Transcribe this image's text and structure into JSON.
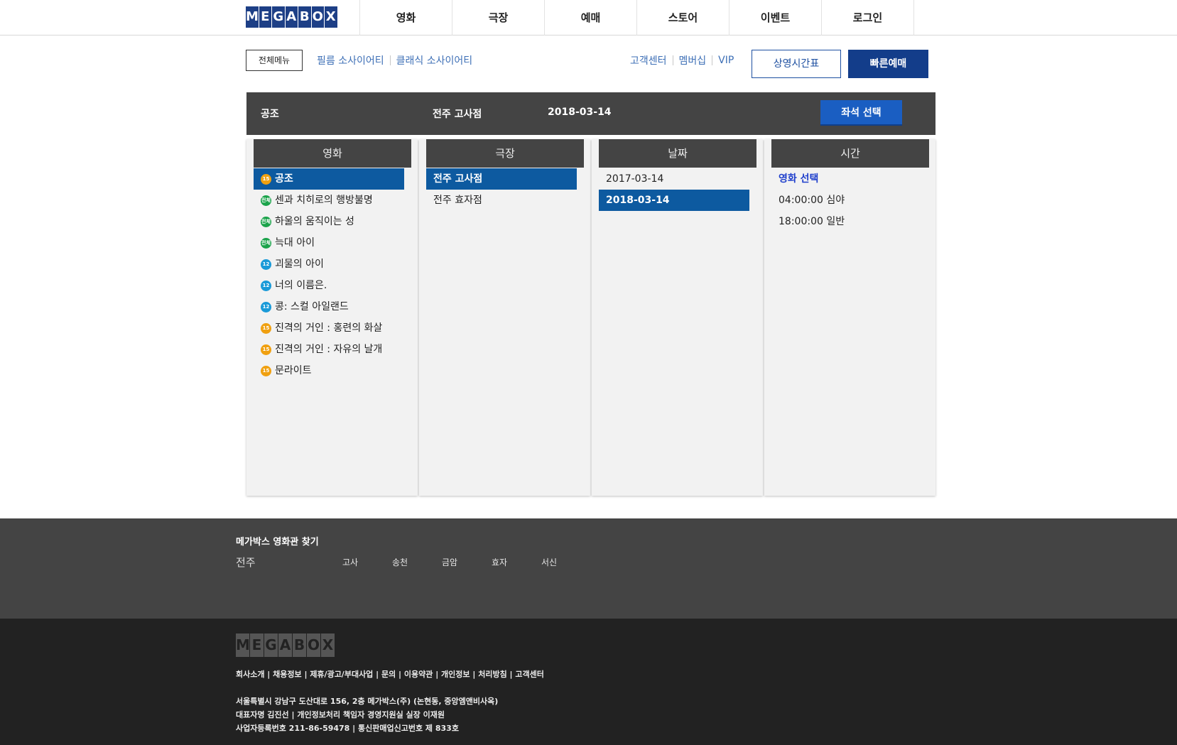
{
  "header": {
    "logo_letters": [
      "M",
      "E",
      "G",
      "A",
      "B",
      "O",
      "X"
    ],
    "menu": [
      "영화",
      "극장",
      "예매",
      "스토어",
      "이벤트",
      "로그인"
    ]
  },
  "subbar": {
    "all_menu": "전체메뉴",
    "society_links": [
      "필름 소사이어티",
      "클래식 소사이어티"
    ],
    "util_links": [
      "고객센터",
      "멤버십",
      "VIP"
    ],
    "schedule": "상영시간표",
    "quick_booking": "빠른예매"
  },
  "summary": {
    "movie": "공조",
    "theater": "전주 고사점",
    "date": "2018-03-14",
    "seat_button": "좌석 선택"
  },
  "columns": {
    "movie": {
      "header": "영화",
      "items": [
        {
          "rating": "15",
          "title": "공조",
          "selected": true
        },
        {
          "rating": "전체",
          "title": "센과 치히로의 행방불명"
        },
        {
          "rating": "전체",
          "title": "하울의 움직이는 성"
        },
        {
          "rating": "전체",
          "title": "늑대 아이"
        },
        {
          "rating": "12",
          "title": "괴물의 아이"
        },
        {
          "rating": "12",
          "title": "너의 이름은."
        },
        {
          "rating": "12",
          "title": "콩: 스컬 아일랜드"
        },
        {
          "rating": "15",
          "title": "진격의 거인 : 홍련의 화살"
        },
        {
          "rating": "15",
          "title": "진격의 거인 : 자유의 날개"
        },
        {
          "rating": "15",
          "title": "문라이트"
        }
      ]
    },
    "theater": {
      "header": "극장",
      "items": [
        {
          "name": "전주 고사점",
          "selected": true
        },
        {
          "name": "전주 효자점"
        }
      ]
    },
    "date": {
      "header": "날짜",
      "items": [
        {
          "value": "2017-03-14"
        },
        {
          "value": "2018-03-14",
          "selected": true
        }
      ]
    },
    "time": {
      "header": "시간",
      "items": [
        {
          "value": "영화 선택",
          "link": true
        },
        {
          "value": "04:00:00 심야"
        },
        {
          "value": "18:00:00 일반"
        }
      ]
    }
  },
  "finder": {
    "title": "메가박스 영화관 찾기",
    "region": "전주",
    "branches": [
      "고사",
      "송천",
      "금암",
      "효자",
      "서신"
    ]
  },
  "footer": {
    "logo_letters": [
      "M",
      "E",
      "G",
      "A",
      "B",
      "O",
      "X"
    ],
    "links": "회사소개 | 채용정보 | 제휴/광고/부대사업 | 문의 | 이용약관 | 개인정보 | 처리방침 | 고객센터",
    "address": "서울특별시 강남구 도산대로 156, 2층 메가박스(주) (논현동, 중앙엠앤비사옥)",
    "ceo": "대표자명 김진선 | 개인정보처리 책임자 경영지원실 실장 이재원",
    "registration": "사업자등록번호 211-86-59478 | 통신판매업신고번호 제 833호"
  },
  "colors": {
    "brand_blue": "#1d3f86",
    "selected_row": "#0d5aa0",
    "dark_panel": "#444444",
    "footer_bg": "#222222",
    "rating_15": "#f0a010",
    "rating_all": "#1aa34a",
    "rating_12": "#1a9ad8"
  }
}
